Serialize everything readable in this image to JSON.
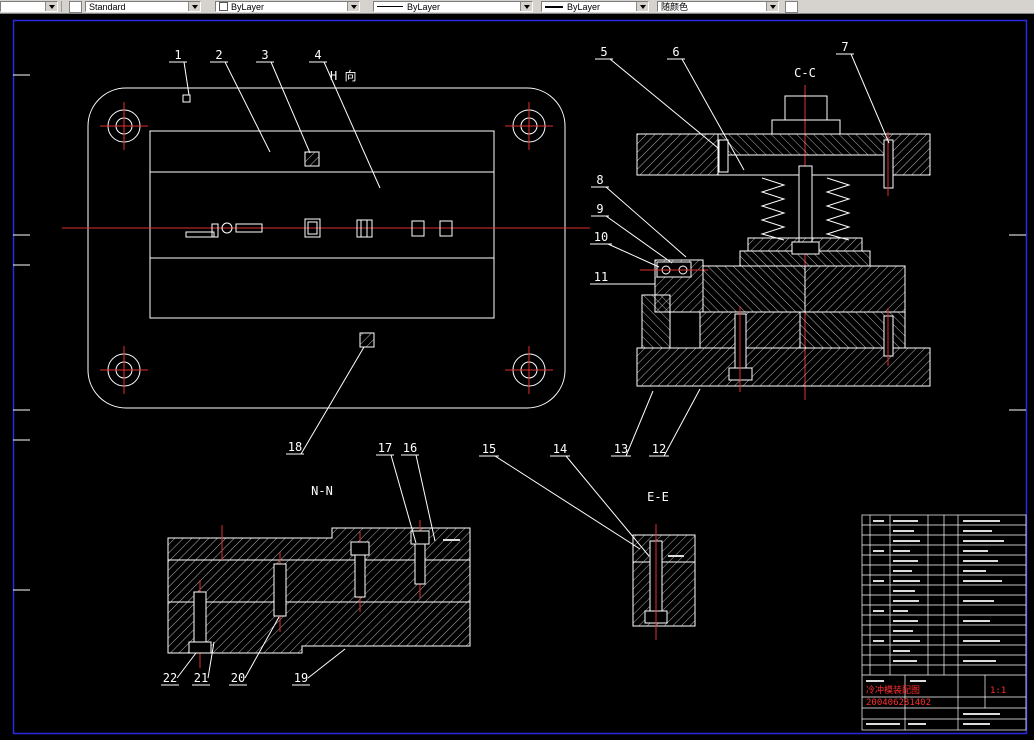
{
  "toolbar": {
    "style_value": "Standard",
    "color_value": "ByLayer",
    "linetype_value": "ByLayer",
    "lineweight_value": "ByLayer",
    "plotstyle_value": "随颜色"
  },
  "drawing": {
    "view_labels": {
      "h": "H 向",
      "cc": "C-C",
      "nn": "N-N",
      "ee": "E-E"
    },
    "callouts": [
      "1",
      "2",
      "3",
      "4",
      "5",
      "6",
      "7",
      "8",
      "9",
      "10",
      "11",
      "12",
      "13",
      "14",
      "15",
      "16",
      "17",
      "18",
      "19",
      "20",
      "21",
      "22"
    ]
  },
  "title_block": {
    "doc_title": "冷冲模装配图",
    "doc_no": "200406281402",
    "scale": "1:1"
  }
}
